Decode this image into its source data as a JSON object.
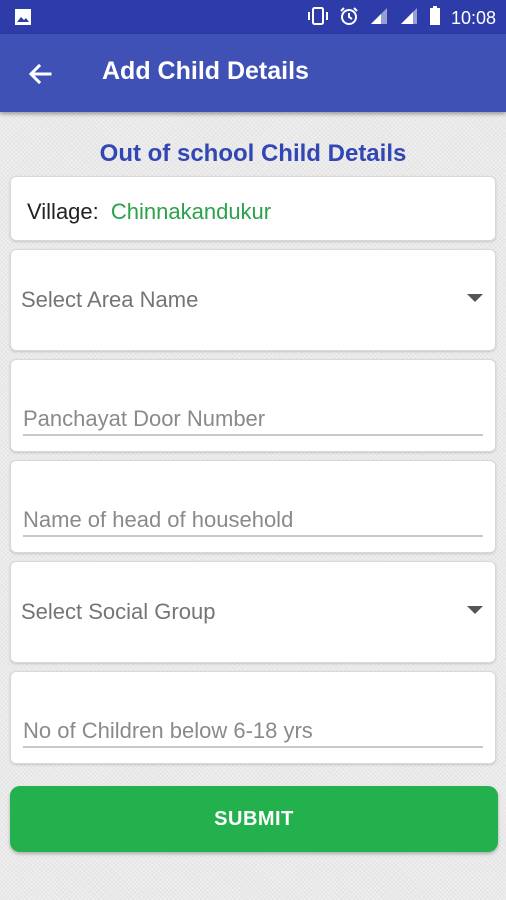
{
  "status_bar": {
    "time": "10:08",
    "icons": [
      "image-icon",
      "vibrate-icon",
      "alarm-icon",
      "signal-icon",
      "signal-icon",
      "battery-icon"
    ]
  },
  "app_bar": {
    "title": "Add Child Details",
    "back_icon": "arrow-left-icon"
  },
  "form": {
    "section_title": "Out of school Child Details",
    "village_label": "Village:",
    "village_value": "Chinnakandukur",
    "area_select_placeholder": "Select Area Name",
    "door_number_placeholder": "Panchayat Door Number",
    "head_of_household_placeholder": "Name of head of household",
    "social_group_placeholder": "Select Social Group",
    "children_count_placeholder": "No of Children below 6-18 yrs",
    "submit_label": "SUBMIT"
  },
  "colors": {
    "status_bar": "#2d3ca9",
    "app_bar": "#3f51b5",
    "section_title": "#3247b4",
    "village_value": "#2aa14a",
    "submit_button": "#22b14c"
  }
}
